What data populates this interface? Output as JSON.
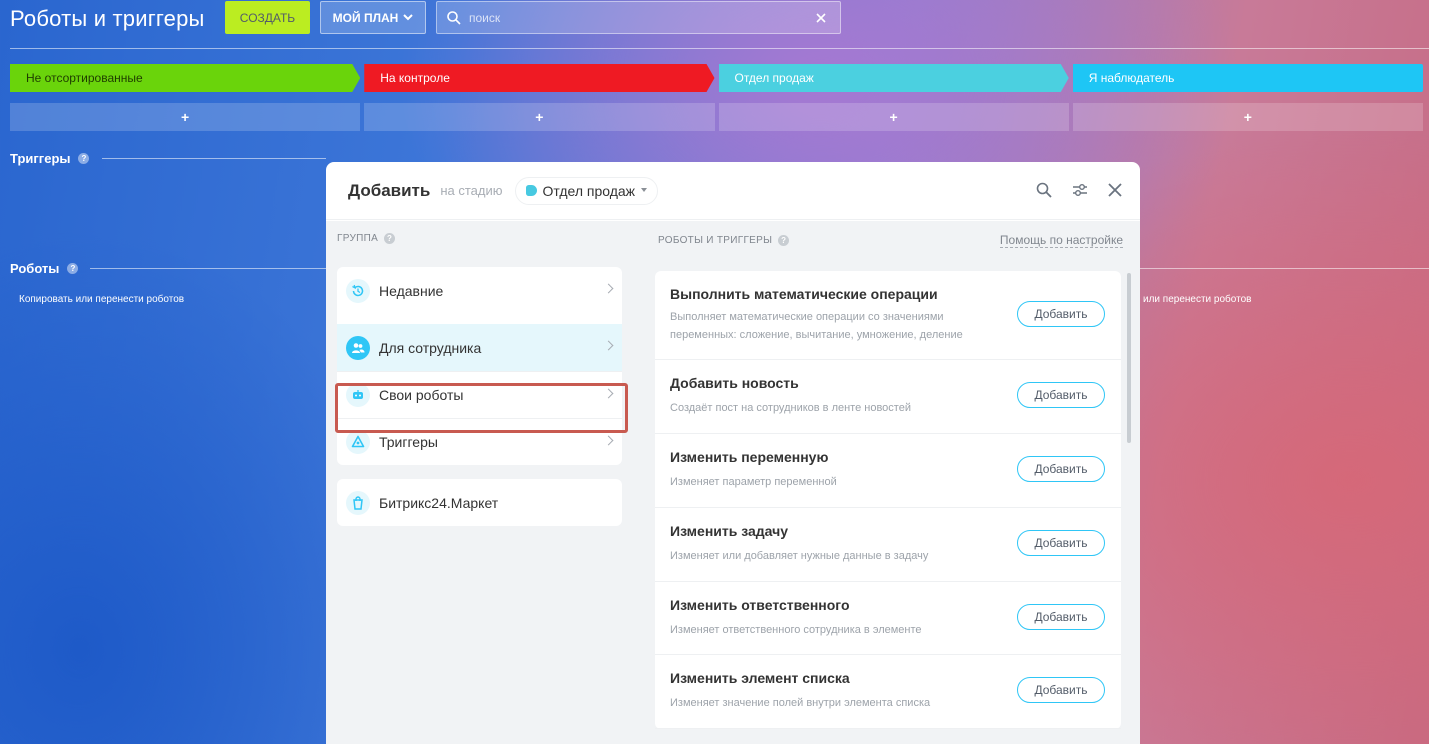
{
  "header": {
    "title": "Роботы и триггеры",
    "create_label": "СОЗДАТЬ",
    "plan_label": "МОЙ ПЛАН",
    "search_placeholder": "поиск"
  },
  "stages": [
    {
      "label": "Не отсортированные",
      "color": "#6ad40b",
      "text_color": "#1f3d00"
    },
    {
      "label": "На контроле",
      "color": "#ef1a23",
      "text_color": "#ffffff"
    },
    {
      "label": "Отдел продаж",
      "color": "#4bd0e0",
      "text_color": "#ffffff"
    },
    {
      "label": "Я наблюдатель",
      "color": "#1ec6f5",
      "text_color": "#ffffff"
    }
  ],
  "add_symbol": "+",
  "sections": {
    "triggers_label": "Триггеры",
    "robots_label": "Роботы",
    "copy_robots_left": "Копировать или перенести роботов",
    "copy_robots_right": "или перенести роботов"
  },
  "modal": {
    "title": "Добавить",
    "subtitle": "на стадию",
    "selected_stage": "Отдел продаж",
    "group_title": "ГРУППА",
    "robots_title": "РОБОТЫ И ТРИГГЕРЫ",
    "help_link": "Помощь по настройке",
    "groups": [
      {
        "label": "Недавние",
        "icon": "history-icon"
      },
      {
        "label": "Для сотрудника",
        "icon": "users-icon",
        "active": true
      },
      {
        "label": "Свои роботы",
        "icon": "robot-icon"
      },
      {
        "label": "Триггеры",
        "icon": "trigger-icon"
      }
    ],
    "market": {
      "label": "Битрикс24.Маркет",
      "icon": "market-icon"
    },
    "robots": [
      {
        "name": "Выполнить математические операции",
        "desc": "Выполняет математические операции со значениями переменных: сложение, вычитание, умножение, деление",
        "button": "Добавить"
      },
      {
        "name": "Добавить новость",
        "desc": "Создаёт пост на сотрудников в ленте новостей",
        "button": "Добавить"
      },
      {
        "name": "Изменить переменную",
        "desc": "Изменяет параметр переменной",
        "button": "Добавить"
      },
      {
        "name": "Изменить задачу",
        "desc": "Изменяет или добавляет нужные данные в задачу",
        "button": "Добавить"
      },
      {
        "name": "Изменить ответственного",
        "desc": "Изменяет ответственного сотрудника в элементе",
        "button": "Добавить"
      },
      {
        "name": "Изменить элемент списка",
        "desc": "Изменяет значение полей внутри элемента списка",
        "button": "Добавить"
      }
    ],
    "accent_color": "#2fc6f6"
  }
}
